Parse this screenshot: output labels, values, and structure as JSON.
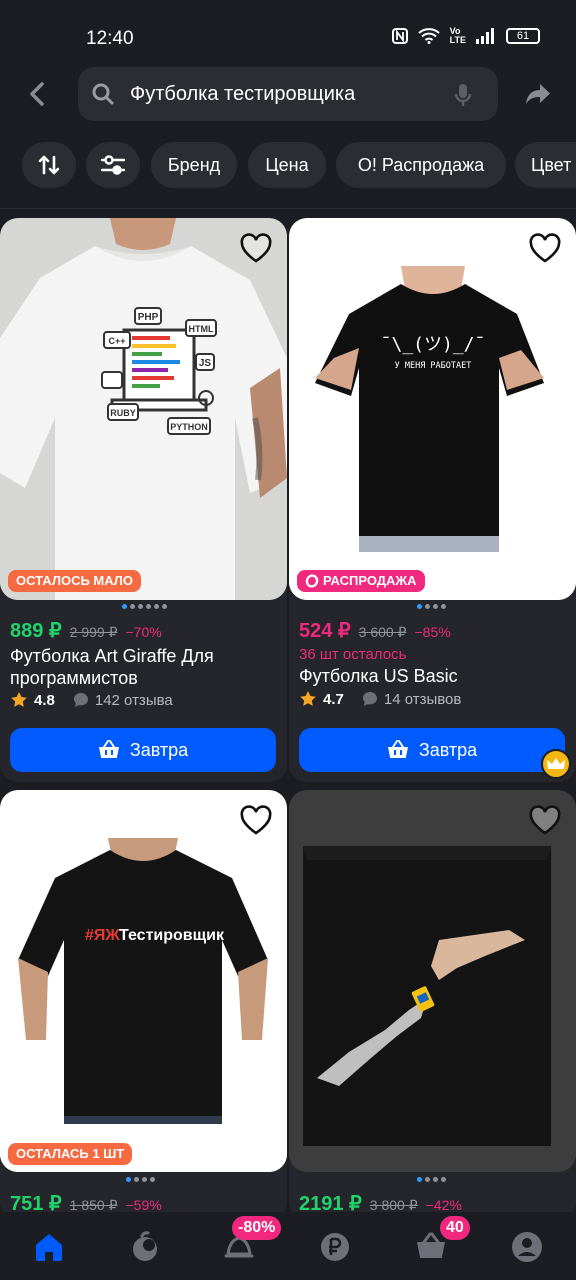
{
  "status": {
    "time": "12:40",
    "battery": "61"
  },
  "search": {
    "query": "Футболка тестировщика"
  },
  "filters": {
    "chips": [
      "Бренд",
      "Цена",
      "О! Распродажа",
      "Цвет"
    ]
  },
  "products": [
    {
      "badge": "ОСТАЛОСЬ МАЛО",
      "price": "889 ₽",
      "old_price": "2 999 ₽",
      "discount": "−70%",
      "title": "Футболка Art Giraffe Для программистов",
      "rating": "4.8",
      "reviews": "142 отзыва",
      "cart_label": "Завтра",
      "print_tags": [
        "PHP",
        "C++",
        "HTML",
        "JS",
        "RUBY",
        "PYTHON"
      ]
    },
    {
      "badge": "РАСПРОДАЖА",
      "price": "524 ₽",
      "old_price": "3 600 ₽",
      "discount": "−85%",
      "stock": "36 шт осталось",
      "title": "Футболка US Basic",
      "rating": "4.7",
      "reviews": "14 отзывов",
      "cart_label": "Завтра",
      "print_face": "¯\\_(ツ)_/¯",
      "print_text": "У МЕНЯ РАБОТАЕТ"
    },
    {
      "badge": "ОСТАЛАСЬ 1 ШТ",
      "price": "751 ₽",
      "old_price": "1 850 ₽",
      "discount": "−59%",
      "print_hash": "#ЯЖ",
      "print_word": "Тестировщик"
    },
    {
      "price": "2191 ₽",
      "old_price": "3 800 ₽",
      "discount": "−42%"
    }
  ],
  "bottom_nav": {
    "sale_badge": "-80%",
    "cart_count": "40"
  },
  "colors": {
    "accent": "#005bff",
    "sale": "#f0297e",
    "price_green": "#20d36b",
    "badge_orange": "#f56a40"
  }
}
